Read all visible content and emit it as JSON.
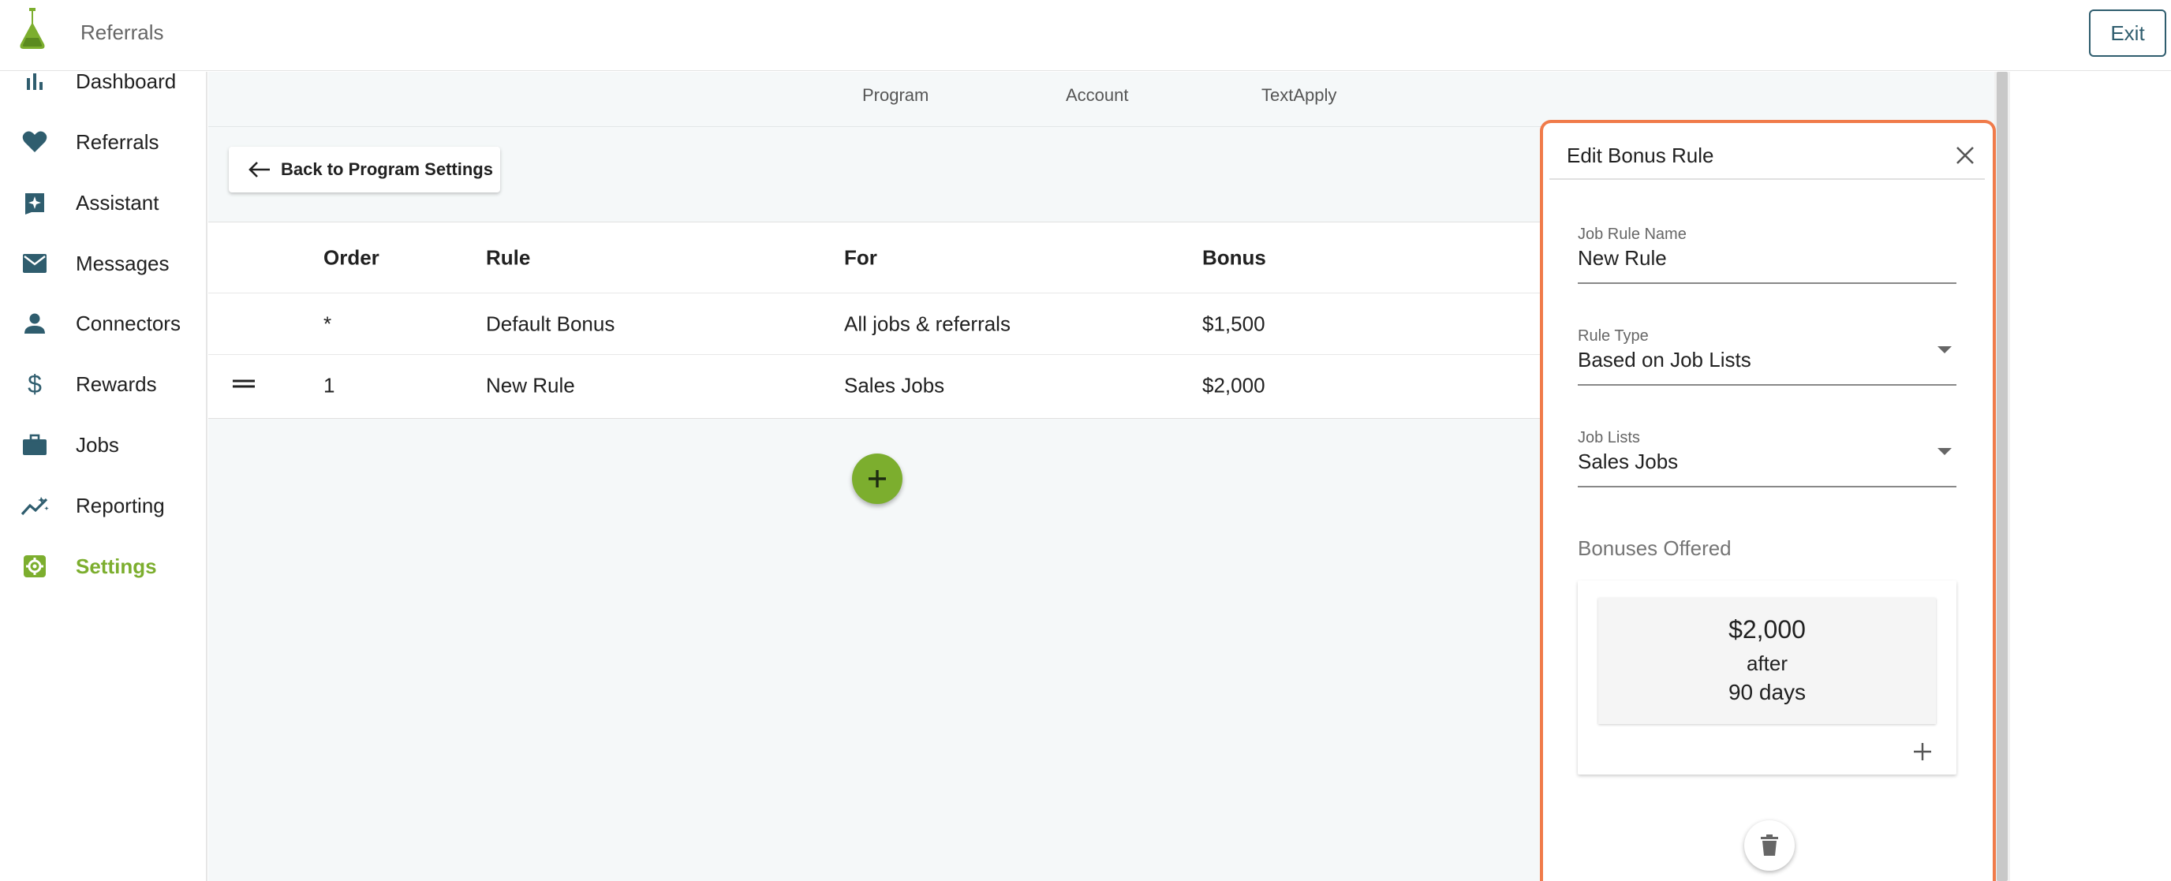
{
  "header": {
    "app_title": "Referrals",
    "exit_label": "Exit"
  },
  "sidebar": {
    "items": [
      {
        "label": "Dashboard",
        "icon": "bar-chart-icon"
      },
      {
        "label": "Referrals",
        "icon": "heart-icon"
      },
      {
        "label": "Assistant",
        "icon": "sparkle-icon"
      },
      {
        "label": "Messages",
        "icon": "envelope-icon"
      },
      {
        "label": "Connectors",
        "icon": "person-icon"
      },
      {
        "label": "Rewards",
        "icon": "dollar-icon"
      },
      {
        "label": "Jobs",
        "icon": "briefcase-icon"
      },
      {
        "label": "Reporting",
        "icon": "trend-icon"
      },
      {
        "label": "Settings",
        "icon": "settings-icon",
        "active": true
      }
    ]
  },
  "tabs": [
    "Program",
    "Account",
    "TextApply"
  ],
  "back_button": {
    "label": "Back to Program Settings"
  },
  "table": {
    "headers": {
      "order": "Order",
      "rule": "Rule",
      "for": "For",
      "bonus": "Bonus"
    },
    "rows": [
      {
        "order": "*",
        "rule": "Default Bonus",
        "for": "All jobs & referrals",
        "bonus": "$1,500"
      },
      {
        "order": "1",
        "rule": "New Rule",
        "for": "Sales Jobs",
        "bonus": "$2,000"
      }
    ]
  },
  "panel": {
    "title": "Edit Bonus Rule",
    "job_rule_name": {
      "label": "Job Rule Name",
      "value": "New Rule"
    },
    "rule_type": {
      "label": "Rule Type",
      "value": "Based on Job Lists"
    },
    "job_lists": {
      "label": "Job Lists",
      "value": "Sales Jobs"
    },
    "bonuses_title": "Bonuses Offered",
    "bonus": {
      "amount": "$2,000",
      "after": "after",
      "days": "90 days"
    }
  },
  "colors": {
    "accent": "#7cae2e",
    "highlight": "#f07b4a",
    "icon": "#2f5d6e"
  }
}
